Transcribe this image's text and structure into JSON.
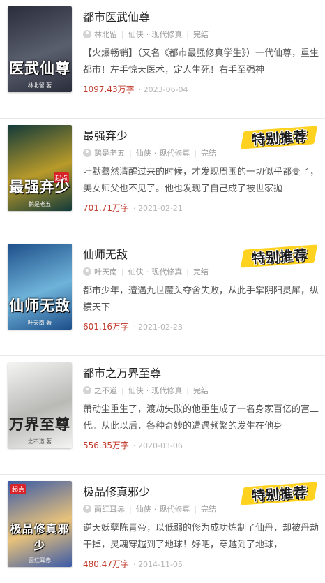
{
  "recommend_label": "特别推荐",
  "books": [
    {
      "title": "都市医武仙尊",
      "author": "林北留",
      "category": "仙侠",
      "subcategory": "现代修真",
      "status": "完结",
      "description": "【火爆畅销】（又名《都市最强修真学生》）一代仙尊，重生都市！左手惊天医术，定人生死！右手至强神",
      "words": "1097.43万字",
      "date": "2023-06-04",
      "cover_title": "医武仙尊",
      "cover_author": "林北留 著",
      "cover_badge": "",
      "recommended": false,
      "cover_colors": [
        "#2a2d3a",
        "#5a5f6e"
      ]
    },
    {
      "title": "最强弃少",
      "author": "鹅是老五",
      "category": "仙侠",
      "subcategory": "现代修真",
      "status": "完结",
      "description": "叶默蓦然清醒过来的时候，才发现周围的一切似乎都变了，美女师父也不见了。他也发现了自己成了被世家抛",
      "words": "701.71万字",
      "date": "2021-02-21",
      "cover_title": "最强弃少",
      "cover_author": "鹅是老五",
      "cover_badge": "起点",
      "recommended": true,
      "cover_colors": [
        "#123a3a",
        "#b89a2a"
      ]
    },
    {
      "title": "仙师无敌",
      "author": "叶天南",
      "category": "仙侠",
      "subcategory": "现代修真",
      "status": "完结",
      "description": "都市少年，遭遇九世魔头夺舍失败，从此手掌阴阳灵犀，纵横天下",
      "words": "601.16万字",
      "date": "2021-02-23",
      "cover_title": "仙师无敌",
      "cover_author": "叶天南 著",
      "cover_badge": "",
      "recommended": true,
      "cover_colors": [
        "#1d4f8a",
        "#6fb3d9"
      ]
    },
    {
      "title": "都市之万界至尊",
      "author": "之不道",
      "category": "仙侠",
      "subcategory": "现代修真",
      "status": "完结",
      "description": "萧动尘重生了，渡劫失败的他重生成了一名身家百亿的富二代。从此以后，各种奇妙的遭遇频繁的发生在他身",
      "words": "556.35万字",
      "date": "2020-03-06",
      "cover_title": "万界至尊",
      "cover_author": "之不道 著",
      "cover_badge": "",
      "recommended": false,
      "cover_colors": [
        "#f4f4f2",
        "#b9b9b6"
      ]
    },
    {
      "title": "极品修真邪少",
      "author": "面红耳赤",
      "category": "仙侠",
      "subcategory": "现代修真",
      "status": "完结",
      "description": "逆天妖孽陈青帝，以低弱的修为成功炼制了仙丹，却被丹劫干掉，灵魂穿越到了地球！好吧，穿越到了地球，",
      "words": "480.47万字",
      "date": "2014-11-05",
      "cover_title": "极品修真邪少",
      "cover_author": "面红耳赤",
      "cover_badge": "起点",
      "recommended": true,
      "cover_colors": [
        "#3a5aa8",
        "#e8c27a"
      ]
    }
  ]
}
